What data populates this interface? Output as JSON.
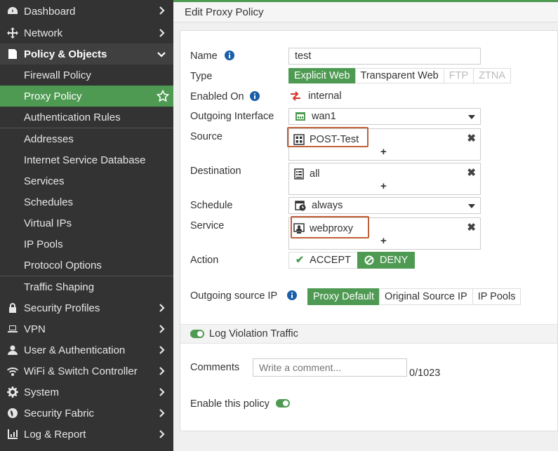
{
  "sidebar": {
    "items": [
      {
        "label": "Dashboard",
        "icon": "dashboard-icon"
      },
      {
        "label": "Network",
        "icon": "network-icon"
      },
      {
        "label": "Policy & Objects",
        "icon": "policy-icon"
      }
    ],
    "policy_sub": [
      {
        "label": "Firewall Policy"
      },
      {
        "label": "Proxy Policy"
      },
      {
        "label": "Authentication Rules"
      },
      {
        "label": "Addresses"
      },
      {
        "label": "Internet Service Database"
      },
      {
        "label": "Services"
      },
      {
        "label": "Schedules"
      },
      {
        "label": "Virtual IPs"
      },
      {
        "label": "IP Pools"
      },
      {
        "label": "Protocol Options"
      },
      {
        "label": "Traffic Shaping"
      }
    ],
    "bottom_items": [
      {
        "label": "Security Profiles",
        "icon": "lock-icon"
      },
      {
        "label": "VPN",
        "icon": "laptop-icon"
      },
      {
        "label": "User & Authentication",
        "icon": "user-icon"
      },
      {
        "label": "WiFi & Switch Controller",
        "icon": "wifi-icon"
      },
      {
        "label": "System",
        "icon": "gear-icon"
      },
      {
        "label": "Security Fabric",
        "icon": "fabric-icon"
      },
      {
        "label": "Log & Report",
        "icon": "chart-icon"
      }
    ]
  },
  "header": {
    "title": "Edit Proxy Policy"
  },
  "form": {
    "name_label": "Name",
    "name_value": "test",
    "type_label": "Type",
    "type_options": [
      "Explicit Web",
      "Transparent Web",
      "FTP",
      "ZTNA"
    ],
    "enabled_on_label": "Enabled On",
    "enabled_on_value": "internal",
    "outgoing_interface_label": "Outgoing Interface",
    "outgoing_interface_value": "wan1",
    "source_label": "Source",
    "source_value": "POST-Test",
    "destination_label": "Destination",
    "destination_value": "all",
    "schedule_label": "Schedule",
    "schedule_value": "always",
    "service_label": "Service",
    "service_value": "webproxy",
    "action_label": "Action",
    "action_accept": "ACCEPT",
    "action_deny": "DENY",
    "outgoing_source_ip_label": "Outgoing source IP",
    "source_ip_options": [
      "Proxy Default",
      "Original Source IP",
      "IP Pools"
    ],
    "log_violation_label": "Log Violation Traffic",
    "comments_label": "Comments",
    "comments_placeholder": "Write a comment...",
    "comments_count": "0/1023",
    "enable_policy_label": "Enable this policy",
    "plus": "+",
    "remove": "✖"
  },
  "colors": {
    "accent": "#4e9a52",
    "sidebar_bg": "#333333",
    "highlight": "#c0603a",
    "info": "#1a5fa8",
    "interface_red": "#d9342b"
  }
}
